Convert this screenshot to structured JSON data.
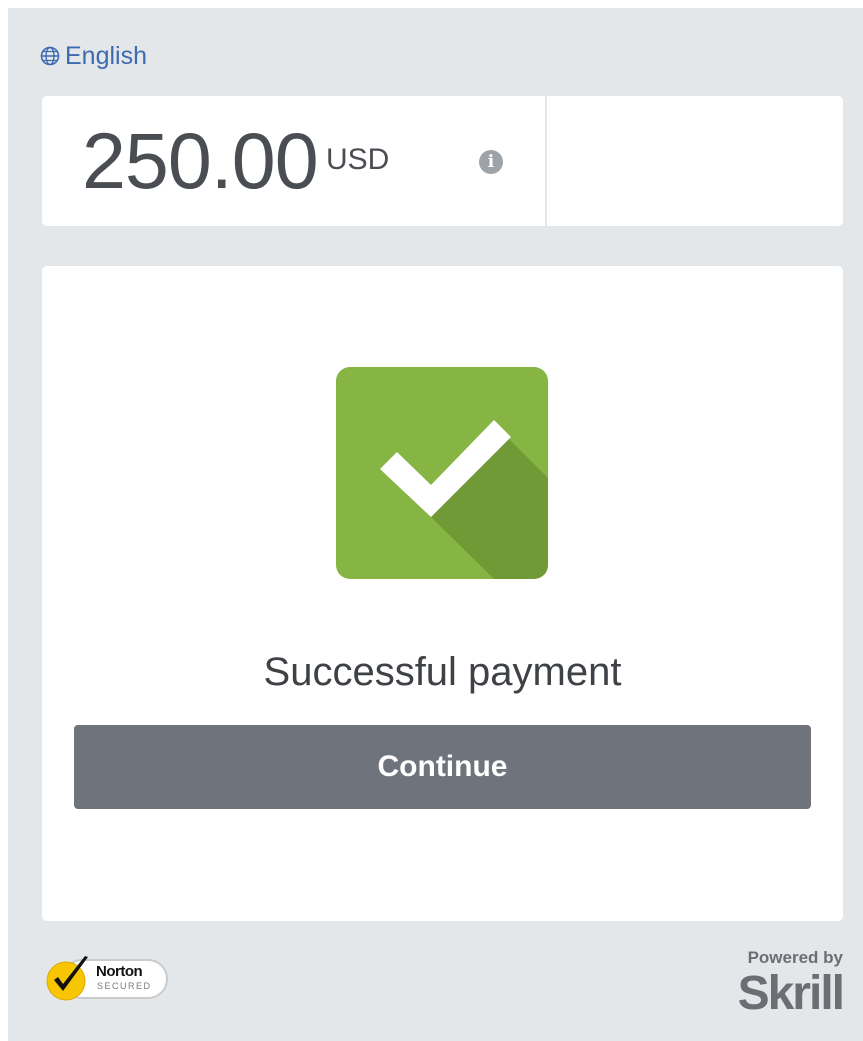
{
  "language": {
    "label": "English",
    "icon": "globe-icon"
  },
  "amount": {
    "value": "250.00",
    "currency": "USD",
    "info_icon": "info-icon",
    "info_glyph": "i"
  },
  "status": {
    "icon": "success-check-icon",
    "message": "Successful payment"
  },
  "actions": {
    "continue_label": "Continue"
  },
  "footer": {
    "norton_brand": "Norton",
    "norton_subtitle": "SECURED",
    "norton_tm": "™",
    "powered_by": "Powered by",
    "skrill_brand": "Skrill"
  },
  "colors": {
    "background": "#e4e7ea",
    "card": "#ffffff",
    "link": "#3d6ab1",
    "success_green": "#86b543",
    "success_shadow": "#6f9a36",
    "button": "#6f747c",
    "skrill_gray": "#6b6f74"
  }
}
